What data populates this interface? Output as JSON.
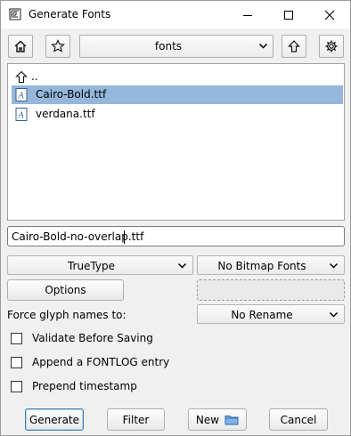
{
  "window": {
    "title": "Generate Fonts",
    "controls": [
      "minimize-icon",
      "maximize-icon",
      "close-icon"
    ]
  },
  "toolbar": {
    "directory": "fonts",
    "buttons": [
      "home-icon",
      "star-icon",
      "arrow-up-icon",
      "gear-icon"
    ]
  },
  "files": [
    {
      "name": "..",
      "icon": "arrow-up-icon",
      "selected": false
    },
    {
      "name": "Cairo-Bold.ttf",
      "icon": "font-file-icon",
      "selected": true
    },
    {
      "name": "verdana.ttf",
      "icon": "font-file-icon",
      "selected": false
    }
  ],
  "filename": {
    "value": "Cairo-Bold-no-overlap.ttf"
  },
  "format": {
    "outline_type": "TrueType",
    "bitmap_type": "No Bitmap Fonts",
    "options_label": "Options"
  },
  "glyph_names": {
    "label": "Force glyph names to:",
    "value": "No Rename"
  },
  "checkboxes": [
    {
      "label": "Validate Before Saving",
      "checked": false
    },
    {
      "label": "Append a FONTLOG entry",
      "checked": false
    },
    {
      "label": "Prepend timestamp",
      "checked": false
    }
  ],
  "buttons": {
    "generate": "Generate",
    "filter": "Filter",
    "new": "New",
    "cancel": "Cancel"
  },
  "colors": {
    "selection": "#94b7db",
    "default_button_border": "#3c7fb1",
    "window_bg": "#f0f0f0"
  }
}
